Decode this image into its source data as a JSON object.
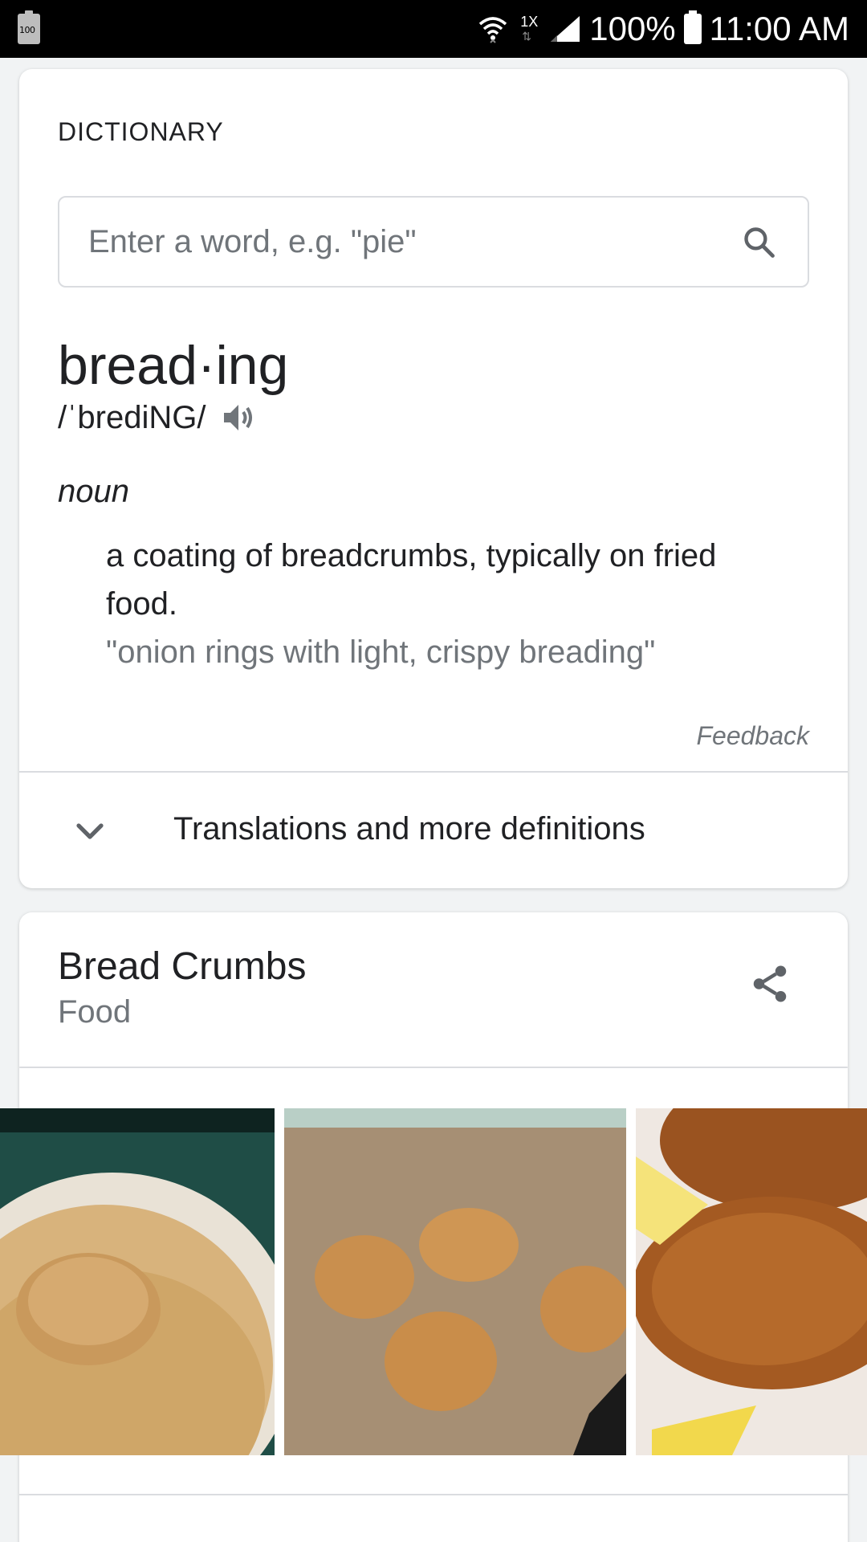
{
  "status_bar": {
    "battery_icon_text": "100",
    "network_rate": "1X",
    "battery_percent": "100%",
    "time": "11:00 AM"
  },
  "dictionary": {
    "section_label": "DICTIONARY",
    "search": {
      "placeholder": "Enter a word, e.g. \"pie\"",
      "value": ""
    },
    "word": "bread·ing",
    "phonetic": "/ˈbrediNG/",
    "part_of_speech": "noun",
    "definition": "a coating of breadcrumbs, typically on fried food.",
    "example": "\"onion rings with light, crispy breading\"",
    "feedback_label": "Feedback",
    "more_label": "Translations and more definitions"
  },
  "entity": {
    "title": "Bread Crumbs",
    "subtitle": "Food",
    "images": [
      {
        "name": "breadcrumbs-plate-image"
      },
      {
        "name": "breaded-patties-tray-image"
      },
      {
        "name": "fried-cutlet-lemon-image"
      }
    ]
  },
  "colors": {
    "text_primary": "#202124",
    "text_secondary": "#70757a",
    "divider": "#dadce0",
    "background": "#f1f3f4"
  }
}
